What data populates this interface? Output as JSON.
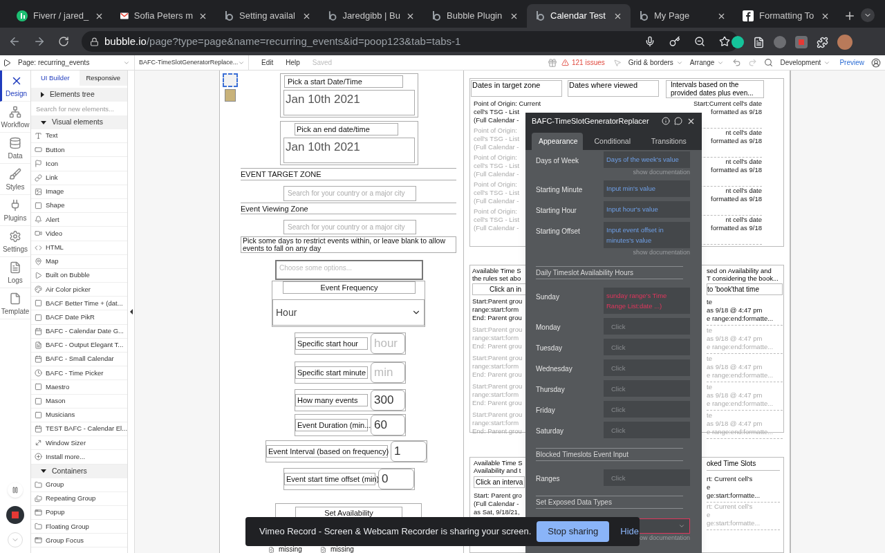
{
  "browser": {
    "tabs": [
      {
        "title": "Fiverr / jared_",
        "kind": "fiverr",
        "selected": false
      },
      {
        "title": "Sofia Peters m",
        "kind": "gmail",
        "selected": false
      },
      {
        "title": "Setting availal",
        "kind": "bubble",
        "selected": false
      },
      {
        "title": "Jaredgibb | Bu",
        "kind": "bubble",
        "selected": false
      },
      {
        "title": "Bubble Plugin",
        "kind": "bubble",
        "selected": false
      },
      {
        "title": "Calendar Test",
        "kind": "bubble",
        "selected": true
      },
      {
        "title": "My Page",
        "kind": "bubble",
        "selected": false
      },
      {
        "title": "Formatting To",
        "kind": "facebook",
        "selected": false
      }
    ],
    "url_host": "bubble.io",
    "url_path": "/page?type=page&name=recurring_events&id=poop123&tab=tabs-1"
  },
  "toolbar": {
    "page": "Page: recurring_events",
    "element": "BAFC-TimeSlotGeneratorReplace...",
    "menus": [
      "Edit",
      "Help"
    ],
    "saved": "Saved",
    "issues": "121 issues",
    "grid": "Grid & borders",
    "arrange": "Arrange",
    "mode": "Development",
    "preview": "Preview"
  },
  "rail": [
    {
      "label": "Design",
      "kind": "design",
      "selected": true
    },
    {
      "label": "Workflow",
      "kind": "workflow",
      "selected": false
    },
    {
      "label": "Data",
      "kind": "data",
      "selected": false
    },
    {
      "label": "Styles",
      "kind": "styles",
      "selected": false
    },
    {
      "label": "Plugins",
      "kind": "plugins",
      "selected": false
    },
    {
      "label": "Settings",
      "kind": "settings",
      "selected": false
    },
    {
      "label": "Logs",
      "kind": "logs",
      "selected": false
    },
    {
      "label": "Template",
      "kind": "template",
      "selected": false
    }
  ],
  "sidebar": {
    "tabs": [
      {
        "label": "UI Builder",
        "selected": true
      },
      {
        "label": "Responsive",
        "selected": false
      }
    ],
    "tree": {
      "label": "Elements tree",
      "expanded": false
    },
    "search_placeholder": "Search for new elements...",
    "sections": [
      {
        "label": "Visual elements",
        "expanded": true,
        "items": [
          {
            "label": "Text",
            "kind": "text"
          },
          {
            "label": "Button",
            "kind": "button"
          },
          {
            "label": "Icon",
            "kind": "flag"
          },
          {
            "label": "Link",
            "kind": "link"
          },
          {
            "label": "Image",
            "kind": "image"
          },
          {
            "label": "Shape",
            "kind": "shape"
          },
          {
            "label": "Alert",
            "kind": "bell"
          },
          {
            "label": "Video",
            "kind": "video"
          },
          {
            "label": "HTML",
            "kind": "code"
          },
          {
            "label": "Map",
            "kind": "pin"
          },
          {
            "label": "Built on Bubble",
            "kind": "bubble"
          },
          {
            "label": "Air Color picker",
            "kind": "palette"
          },
          {
            "label": "BACF Better Time + (dat...",
            "kind": "square"
          },
          {
            "label": "BACF Date PikR",
            "kind": "square"
          },
          {
            "label": "BAFC - Calendar Date G...",
            "kind": "calendar"
          },
          {
            "label": "BAFC - Output Elegant T...",
            "kind": "doc"
          },
          {
            "label": "BAFC - Small Calendar",
            "kind": "calendar"
          },
          {
            "label": "BAFC - Time Picker",
            "kind": "clock"
          },
          {
            "label": "Maestro",
            "kind": "square"
          },
          {
            "label": "Mason",
            "kind": "square"
          },
          {
            "label": "Musicians",
            "kind": "square"
          },
          {
            "label": "TEST BAFC - Calendar El...",
            "kind": "calendar"
          },
          {
            "label": "Window Sizer",
            "kind": "resize"
          },
          {
            "label": "Install more...",
            "kind": "plus"
          }
        ]
      },
      {
        "label": "Containers",
        "expanded": true,
        "items": [
          {
            "label": "Group",
            "kind": "folder"
          },
          {
            "label": "Repeating Group",
            "kind": "folders"
          },
          {
            "label": "Popup",
            "kind": "popup"
          },
          {
            "label": "Floating Group",
            "kind": "folder"
          },
          {
            "label": "Group Focus",
            "kind": "popup"
          }
        ]
      }
    ]
  },
  "form": {
    "start_label": "Pick a start Date/Time",
    "start_value": "Jan 10th 2021",
    "end_label": "Pick an end date/time",
    "end_value": "Jan 10th 2021",
    "target_zone": "EVENT TARGET ZONE",
    "target_placeholder": "Search for your country or a major city",
    "viewing_zone": "Event Viewing Zone",
    "viewing_placeholder": "Search for your country or a major city",
    "days_note": "Pick some days to restrict events within, or leave blank to allow events to fall on any day",
    "days_placeholder": "Choose some options...",
    "frequency_label": "Event Frequency",
    "frequency_value": "Hour",
    "inputs": [
      {
        "label": "Specific start hour",
        "placeholder": "hour"
      },
      {
        "label": "Specific start minute",
        "placeholder": "min"
      },
      {
        "label": "How many events",
        "value": "300"
      },
      {
        "label": "Event Duration (min...",
        "value": "60"
      },
      {
        "label": "Event Interval (based on frequency)",
        "value": "1"
      },
      {
        "label": "Event start time offset (min)",
        "value": "0"
      }
    ],
    "availability": "Set Availability",
    "missing": [
      "missing",
      "missing"
    ]
  },
  "groups": [
    {
      "headers": [
        "Dates in target zone",
        "Dates where viewed",
        "Intervals based on the provided dates plus even..."
      ],
      "left": [
        {
          "lines": [
            "Point of Origin: Current",
            "cell's TSG - List",
            "(Full Calendar -"
          ],
          "dim": false
        },
        {
          "lines": [
            "Point of Origin:",
            "cell's TSG - List",
            "(Full Calendar -"
          ],
          "dim": true
        },
        {
          "lines": [
            "Point of Origin:",
            "cell's TSG - List",
            "(Full Calendar -"
          ],
          "dim": true
        },
        {
          "lines": [
            "Point of Origin:",
            "cell's TSG - List",
            "(Full Calendar -"
          ],
          "dim": true
        },
        {
          "lines": [
            "Point of Origin:",
            "cell's TSG - List",
            "(Full Calendar -"
          ],
          "dim": true
        }
      ],
      "right": [
        {
          "lines": [
            "Start:Current cell's date",
            "formatted as 9/18"
          ],
          "dim": false
        },
        {
          "lines": [
            "nt cell's date",
            "formatted as 9/18"
          ],
          "dim": false
        },
        {
          "lines": [
            "nt cell's date",
            "formatted as 9/18"
          ],
          "dim": false
        },
        {
          "lines": [
            "nt cell's date",
            "formatted as 9/18"
          ],
          "dim": false
        },
        {
          "lines": [
            "nt cell's date",
            "formatted as 9/18"
          ],
          "dim": false
        }
      ]
    },
    {
      "left_title": [
        "Available Time S",
        "the rules set abo"
      ],
      "left_button": "Click an in",
      "right_title": [
        "sed on Availability and",
        "T considering the book..."
      ],
      "right_button": "to 'book'that time",
      "left": [
        {
          "lines": [
            "Start:Parent grou",
            "range:start:form",
            "End: Parent grou"
          ],
          "dim": false
        },
        {
          "lines": [
            "Start:Parent grou",
            "range:start:form",
            "End: Parent grou"
          ],
          "dim": true
        },
        {
          "lines": [
            "Start:Parent grou",
            "range:start:form",
            "End: Parent grou"
          ],
          "dim": true
        },
        {
          "lines": [
            "Start:Parent grou",
            "range:start:form",
            "End: Parent grou"
          ],
          "dim": true
        },
        {
          "lines": [
            "Start:Parent grou",
            "range:start:form",
            "End: Parent grou"
          ],
          "dim": true
        }
      ],
      "right": [
        {
          "lines": [
            "te",
            "as 9/18 @ 4:47 pm",
            "e range:end:formatte..."
          ],
          "dim": false
        },
        {
          "lines": [
            "te",
            "as 9/18 @ 4:47 pm",
            "e range:end:formatte..."
          ],
          "dim": true
        },
        {
          "lines": [
            "te",
            "as 9/18 @ 4:47 pm",
            "e range:end:formatte..."
          ],
          "dim": true
        },
        {
          "lines": [
            "te",
            "as 9/18 @ 4:47 pm",
            "e range:end:formatte..."
          ],
          "dim": true
        },
        {
          "lines": [
            "te",
            "as 9/18 @ 4:47 pm",
            "e range:end:formatte..."
          ],
          "dim": true
        }
      ]
    },
    {
      "left_title": [
        "Available Time S",
        "Availability and t"
      ],
      "left_button": "Click an interva",
      "right_title": [
        "oked Time Slots"
      ],
      "left": [
        {
          "lines": [
            "Start:  Parent gro",
            "(Full Calendar -",
            "as Sat, 9/18/21,"
          ],
          "dim": false
        }
      ],
      "right": [
        {
          "lines": [
            "rt:  Current cell's",
            "e",
            "ge:start:formatte..."
          ],
          "dim": false
        },
        {
          "lines": [
            "rt:  Current cell's",
            "e",
            "ge:start:formatte..."
          ],
          "dim": true
        }
      ]
    }
  ],
  "panel": {
    "title": "BAFC-TimeSlotGeneratorReplacer",
    "tabs": [
      {
        "label": "Appearance",
        "selected": true
      },
      {
        "label": "Conditional",
        "selected": false
      },
      {
        "label": "Transitions",
        "selected": false
      }
    ],
    "rows": [
      {
        "kind": "dynamic_field",
        "label": "Days of Week",
        "value": "Days of the week's value"
      },
      {
        "kind": "doc",
        "text": "show documentation"
      },
      {
        "kind": "dynamic_field",
        "label": "Starting Minute",
        "value": "Input min's value"
      },
      {
        "kind": "dynamic_field",
        "label": "Starting Hour",
        "value": "Input hour's value"
      },
      {
        "kind": "dynamic_field",
        "label": "Starting Offset",
        "value": "Input event offset in minutes's value"
      },
      {
        "kind": "doc",
        "text": "show documentation"
      },
      {
        "kind": "section",
        "text": "Daily Timeslot Availability Hours"
      },
      {
        "kind": "error_field",
        "label": "Sunday",
        "value": "sunday range's Time Range List:date ...)"
      },
      {
        "kind": "empty_field",
        "label": "Monday",
        "placeholder": "Click"
      },
      {
        "kind": "empty_field",
        "label": "Tuesday",
        "placeholder": "Click"
      },
      {
        "kind": "empty_field",
        "label": "Wednesday",
        "placeholder": "Click"
      },
      {
        "kind": "empty_field",
        "label": "Thursday",
        "placeholder": "Click"
      },
      {
        "kind": "empty_field",
        "label": "Friday",
        "placeholder": "Click"
      },
      {
        "kind": "empty_field",
        "label": "Saturday",
        "placeholder": "Click"
      },
      {
        "kind": "section",
        "text": "Blocked Timeslots Event Input"
      },
      {
        "kind": "empty_field",
        "label": "Ranges",
        "placeholder": "Click"
      },
      {
        "kind": "section",
        "text": "Set Exposed Data Types"
      },
      {
        "kind": "error_select"
      },
      {
        "kind": "doc",
        "text": "ow documentation"
      }
    ]
  },
  "share": {
    "message": "Vimeo Record - Screen & Webcam Recorder is sharing your screen.",
    "stop": "Stop sharing",
    "hide": "Hide"
  }
}
